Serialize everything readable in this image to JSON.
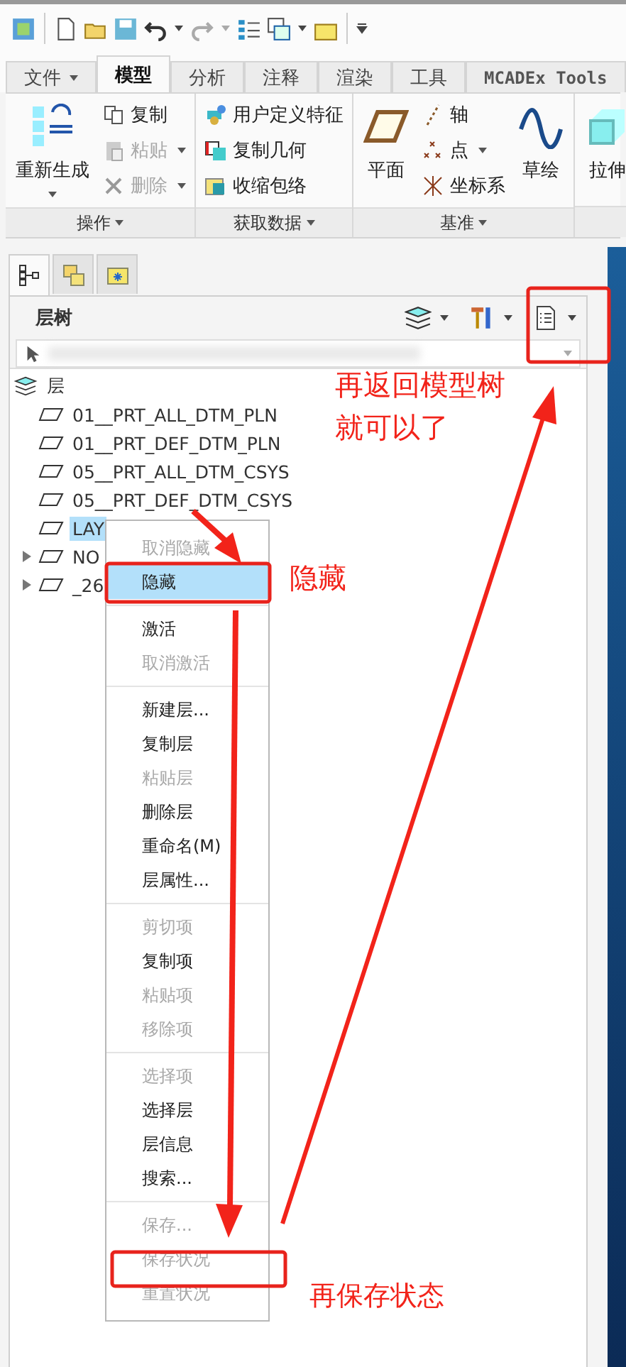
{
  "ribbon": {
    "tabs": [
      {
        "label": "文件",
        "selected": false,
        "dropdown": true
      },
      {
        "label": "模型",
        "selected": true,
        "dropdown": false
      },
      {
        "label": "分析",
        "selected": false,
        "dropdown": false
      },
      {
        "label": "注释",
        "selected": false,
        "dropdown": false
      },
      {
        "label": "渲染",
        "selected": false,
        "dropdown": false
      },
      {
        "label": "工具",
        "selected": false,
        "dropdown": false
      },
      {
        "label": "MCADEx Tools",
        "selected": false,
        "dropdown": false
      }
    ],
    "groups": [
      {
        "label": "操作",
        "commands": [
          {
            "label": "重新生成",
            "kind": "large",
            "disabled": false,
            "dropdown": true
          },
          {
            "label": "复制",
            "kind": "small",
            "disabled": false,
            "dropdown": false
          },
          {
            "label": "粘贴",
            "kind": "small",
            "disabled": true,
            "dropdown": true
          },
          {
            "label": "删除",
            "kind": "small",
            "disabled": true,
            "dropdown": true
          }
        ]
      },
      {
        "label": "获取数据",
        "commands": [
          {
            "label": "用户定义特征",
            "kind": "small",
            "disabled": false,
            "dropdown": false
          },
          {
            "label": "复制几何",
            "kind": "small",
            "disabled": false,
            "dropdown": false
          },
          {
            "label": "收缩包络",
            "kind": "small",
            "disabled": false,
            "dropdown": false
          }
        ]
      },
      {
        "label": "基准",
        "commands": [
          {
            "label": "平面",
            "kind": "large",
            "disabled": false,
            "dropdown": false
          },
          {
            "label": "轴",
            "kind": "small",
            "disabled": false,
            "dropdown": false
          },
          {
            "label": "点",
            "kind": "small",
            "disabled": false,
            "dropdown": true
          },
          {
            "label": "坐标系",
            "kind": "small",
            "disabled": false,
            "dropdown": false
          },
          {
            "label": "草绘",
            "kind": "large",
            "disabled": false,
            "dropdown": false
          }
        ]
      },
      {
        "commands": [
          {
            "label": "拉伸",
            "kind": "large",
            "disabled": false,
            "dropdown": false
          }
        ]
      }
    ]
  },
  "panel": {
    "tabs": [
      {
        "selected": true
      },
      {
        "selected": false
      },
      {
        "selected": false
      }
    ],
    "title": "层树",
    "tree": {
      "label": "层",
      "children": [
        {
          "label": "01__PRT_ALL_DTM_PLN",
          "selected": false,
          "expandable": false
        },
        {
          "label": "01__PRT_DEF_DTM_PLN",
          "selected": false,
          "expandable": false
        },
        {
          "label": "05__PRT_ALL_DTM_CSYS",
          "selected": false,
          "expandable": false
        },
        {
          "label": "05__PRT_DEF_DTM_CSYS",
          "selected": false,
          "expandable": false
        },
        {
          "label": "LAY",
          "selected": true,
          "expandable": false
        },
        {
          "label": "NO",
          "selected": false,
          "expandable": true
        },
        {
          "label": "_26",
          "selected": false,
          "expandable": true
        }
      ]
    }
  },
  "context_menu": {
    "groups": [
      [
        {
          "label": "取消隐藏",
          "disabled": true,
          "selected": false
        },
        {
          "label": "隐藏",
          "disabled": false,
          "selected": true
        }
      ],
      [
        {
          "label": "激活",
          "disabled": false,
          "selected": false
        },
        {
          "label": "取消激活",
          "disabled": true,
          "selected": false
        }
      ],
      [
        {
          "label": "新建层...",
          "disabled": false,
          "selected": false
        },
        {
          "label": "复制层",
          "disabled": false,
          "selected": false
        },
        {
          "label": "粘贴层",
          "disabled": true,
          "selected": false
        },
        {
          "label": "删除层",
          "disabled": false,
          "selected": false
        },
        {
          "label": "重命名(M)",
          "disabled": false,
          "selected": false
        },
        {
          "label": "层属性...",
          "disabled": false,
          "selected": false
        }
      ],
      [
        {
          "label": "剪切项",
          "disabled": true,
          "selected": false
        },
        {
          "label": "复制项",
          "disabled": false,
          "selected": false
        },
        {
          "label": "粘贴项",
          "disabled": true,
          "selected": false
        },
        {
          "label": "移除项",
          "disabled": true,
          "selected": false
        }
      ],
      [
        {
          "label": "选择项",
          "disabled": true,
          "selected": false
        },
        {
          "label": "选择层",
          "disabled": false,
          "selected": false
        },
        {
          "label": "层信息",
          "disabled": false,
          "selected": false
        },
        {
          "label": "搜索...",
          "disabled": false,
          "selected": false
        }
      ],
      [
        {
          "label": "保存...",
          "disabled": true,
          "selected": false
        },
        {
          "label": "保存状况",
          "disabled": true,
          "selected": false
        },
        {
          "label": "重置状况",
          "disabled": true,
          "selected": false
        }
      ]
    ]
  },
  "annotations": [
    {
      "text": "再返回模型树"
    },
    {
      "text": "就可以了"
    },
    {
      "text": "隐藏"
    },
    {
      "text": "再保存状态"
    }
  ]
}
